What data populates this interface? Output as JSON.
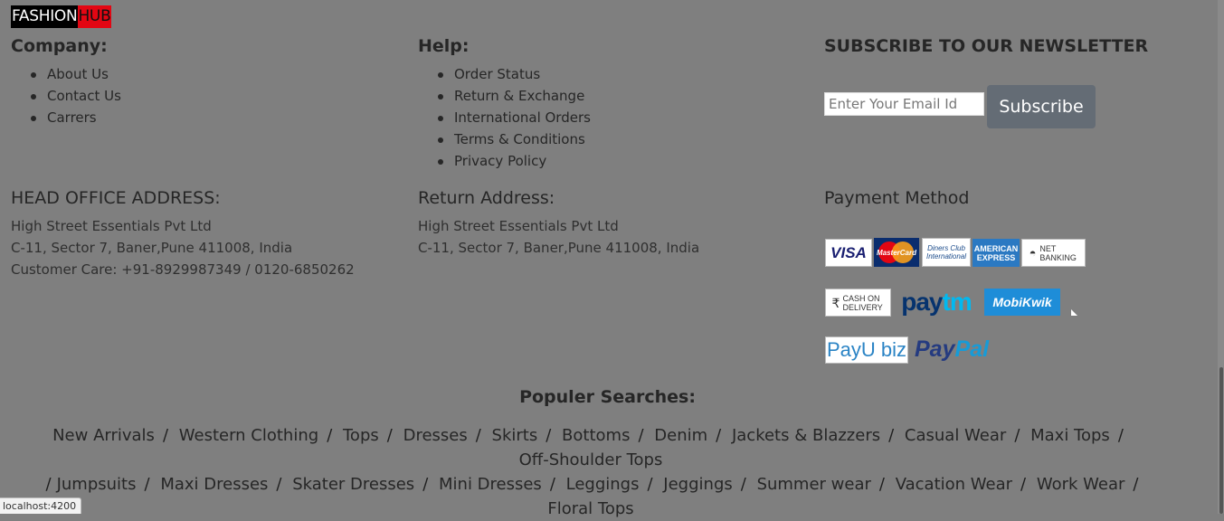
{
  "brand": {
    "part1": "FASHION",
    "part2": "HUB"
  },
  "company": {
    "title": "Company:",
    "links": [
      "About Us",
      "Contact Us",
      "Carrers"
    ]
  },
  "help": {
    "title": "Help:",
    "links": [
      "Order Status",
      "Return & Exchange",
      "International Orders",
      "Terms & Conditions",
      "Privacy Policy"
    ]
  },
  "newsletter": {
    "title": "SUBSCRIBE TO OUR NEWSLETTER",
    "placeholder": "Enter Your Email Id",
    "button": "Subscribe"
  },
  "head_office": {
    "title": "HEAD OFFICE ADDRESS:",
    "lines": [
      "High Street Essentials Pvt Ltd",
      "C-11, Sector 7, Baner,Pune 411008, India",
      "Customer Care: +91-8929987349 / 0120-6850262"
    ]
  },
  "return_address": {
    "title": "Return Address:",
    "lines": [
      "High Street Essentials Pvt Ltd",
      "C-11, Sector 7, Baner,Pune 411008, India"
    ]
  },
  "payment": {
    "title": "Payment Method",
    "logos": {
      "visa": "VISA",
      "mastercard": "MasterCard",
      "diners": "Diners Club International",
      "amex": "AMERICAN EXPRESS",
      "net_banking": "NET BANKING",
      "cod": "CASH ON DELIVERY",
      "paytm_a": "pay",
      "paytm_b": "tm",
      "mobikwik": "MobiKwik",
      "payu_a": "PayU",
      "payu_b": "biz",
      "paypal_a": "Pay",
      "paypal_b": "Pal"
    }
  },
  "popular": {
    "title": "Populer Searches:",
    "items": [
      "New Arrivals",
      "Western Clothing",
      "Tops",
      "Dresses",
      "Skirts",
      "Bottoms",
      "Denim",
      "Jackets & Blazzers",
      "Casual Wear",
      "Maxi Tops",
      "Off-Shoulder Tops",
      "Jumpsuits",
      "Maxi Dresses",
      "Skater Dresses",
      "Mini Dresses",
      "Leggings",
      "Jeggings",
      "Summer wear",
      "Vacation Wear",
      "Work Wear",
      "Floral Tops"
    ],
    "separator": "/"
  },
  "status_bar": {
    "url": "localhost:4200"
  }
}
